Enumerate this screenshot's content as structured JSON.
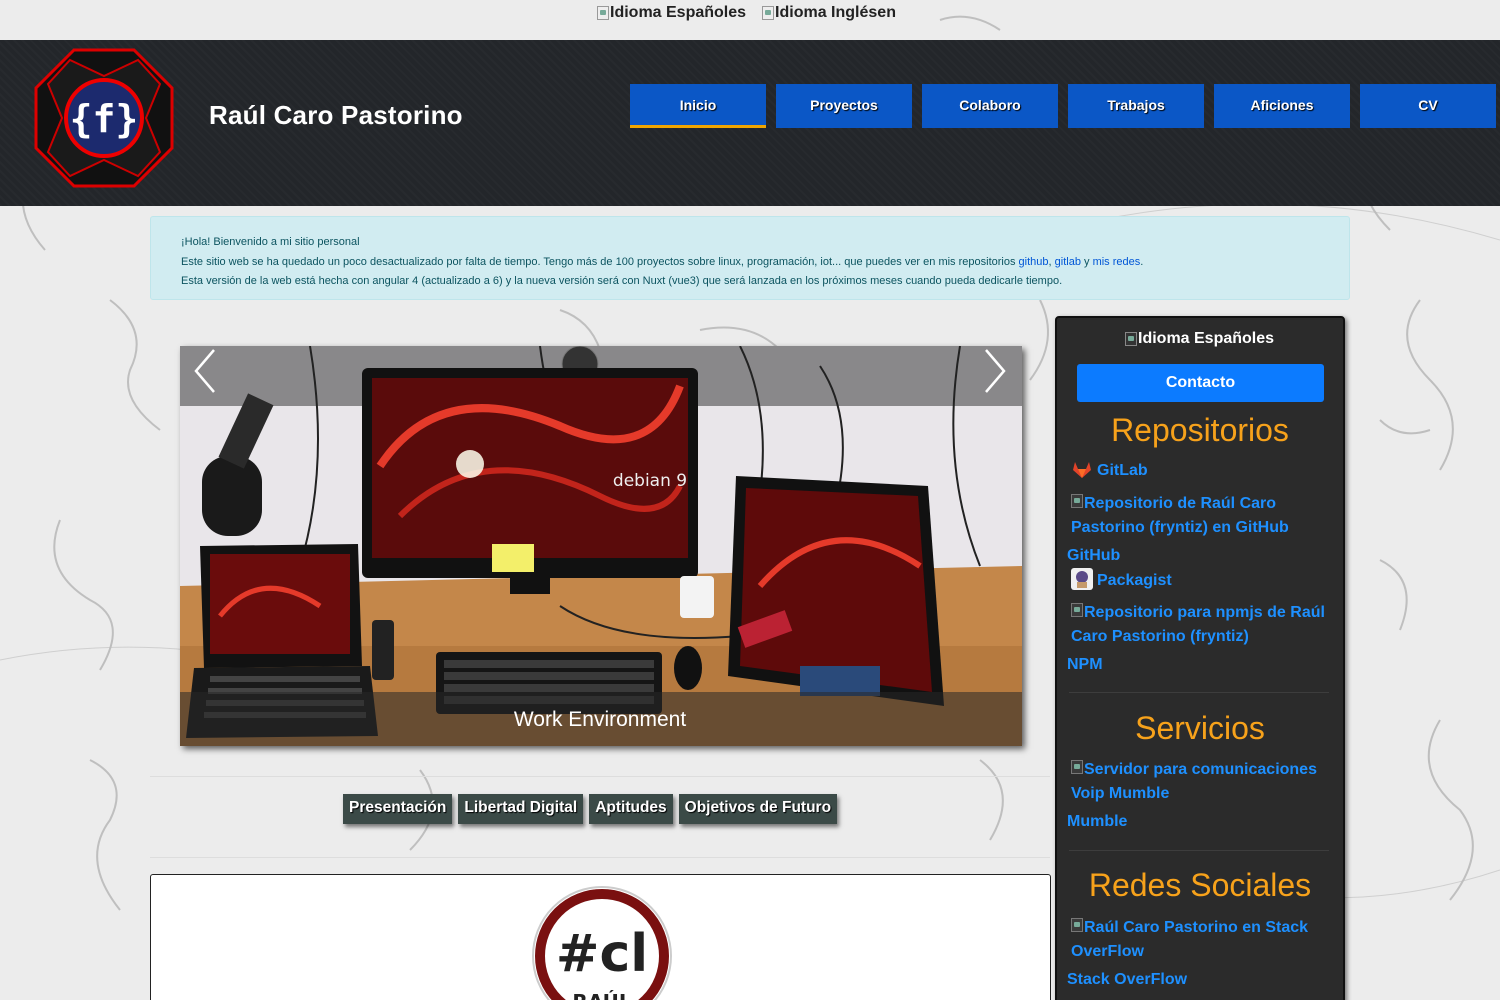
{
  "top_lang": {
    "spanish_alt": "Idioma Españoles",
    "english_alt": "Idioma Inglésen"
  },
  "header": {
    "site_title": "Raúl Caro Pastorino",
    "logo_text": "{f}",
    "nav": [
      {
        "label": "Inicio",
        "active": true
      },
      {
        "label": "Proyectos",
        "active": false
      },
      {
        "label": "Colaboro",
        "active": false
      },
      {
        "label": "Trabajos",
        "active": false
      },
      {
        "label": "Aficiones",
        "active": false
      },
      {
        "label": "CV",
        "active": false
      }
    ]
  },
  "alert": {
    "line1": "¡Hola! Bienvenido a mi sitio personal",
    "line2_pre": "Este sitio web se ha quedado un poco desactualizado por falta de tiempo. Tengo más de 100 proyectos sobre linux, programación, iot... que puedes ver en mis repositorios ",
    "link_github": "github",
    "sep_comma": ", ",
    "link_gitlab": "gitlab",
    "sep_y": " y ",
    "link_redes": "mis redes",
    "line2_post": ".",
    "line3": "Esta versión de la web está hecha con angular 4 (actualizado a 6) y la nueva versión será con Nuxt (vue3) que será lanzada en los próximos meses cuando pueda dedicarle tiempo."
  },
  "carousel": {
    "caption": "Work Environment",
    "screen_text": "debian 9",
    "prev_icon": "chevron-left-icon",
    "next_icon": "chevron-right-icon"
  },
  "tabs": [
    "Presentación",
    "Libertad Digital",
    "Aptitudes",
    "Objetivos de Futuro"
  ],
  "content": {
    "avatar_text": "#cl",
    "avatar_name": "RAÚL"
  },
  "sidebar": {
    "lang_alt": "Idioma Españoles",
    "contact_label": "Contacto",
    "repos_heading": "Repositorios",
    "gitlab_label": "GitLab",
    "github_alt": "Repositorio de Raúl Caro Pastorino (fryntiz) en GitHub",
    "github_label": "GitHub",
    "packagist_label": "Packagist",
    "npm_alt": "Repositorio para npmjs de Raúl Caro Pastorino (fryntiz)",
    "npm_label": "NPM",
    "services_heading": "Servicios",
    "mumble_alt": "Servidor para comunicaciones Voip Mumble",
    "mumble_label": "Mumble",
    "social_heading": "Redes Sociales",
    "stack_alt": "Raúl Caro Pastorino en Stack OverFlow",
    "stack_label": "Stack OverFlow"
  },
  "colors": {
    "nav_blue": "#0b57c6",
    "nav_active_underline": "#f0a500",
    "sidebar_heading": "#f7a21b",
    "link_blue": "#1e90ff",
    "contact_button": "#0c7bff",
    "header_bg": "#23262a"
  }
}
